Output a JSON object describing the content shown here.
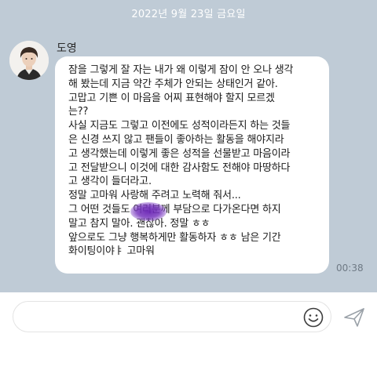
{
  "header": {
    "date": "2022년 9월 23일 금요일"
  },
  "message": {
    "sender": "도영",
    "lines": [
      "잠을 그렇게 잘 자는 내가 왜 이렇게 잠이 안 오나 생각",
      "해 봤는데 지금 약간 주체가 안되는 상태인거 같아.",
      "고맙고 기쁜 이 마음을 어찌 표현해야 할지 모르겠",
      "는??",
      "사실 지금도 그렇고 이전에도 성적이라든지 하는 것들",
      "은 신경 쓰지 않고 팬들이 좋아하는 활동을 해야지라",
      "고 생각했는데 이렇게 좋은 성적을 선물받고 마음이라",
      "고 전달받으니 이것에 대한 감사함도 전해야 마땅하다",
      "고 생각이 들더라고.",
      "정말 고마워 사랑해 주려고 노력해 줘서...",
      "그 어떤 것들도 여러분께 부담으로 다가온다면 하지",
      "말고 참지 말아. 괜찮아. 정말 ㅎㅎ",
      "앞으로도 그냥 행복하게만 활동하자 ㅎㅎ 남은 기간",
      "화이팅이야ㅑ 고마워"
    ],
    "time": "00:38"
  },
  "input": {
    "placeholder": ""
  },
  "icons": {
    "emoji": "smiley-icon",
    "send": "send-icon"
  },
  "colors": {
    "chat_background": "#bfcbd6",
    "bubble": "#ffffff",
    "input_bar": "#ffffff"
  }
}
